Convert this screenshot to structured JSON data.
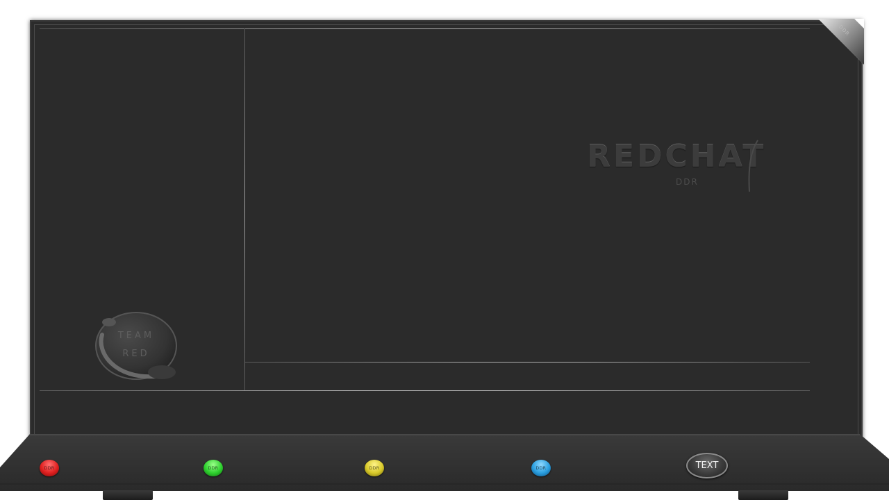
{
  "screen": {
    "brand": {
      "name": "REDCHAT",
      "sub": "DDR"
    },
    "badge": {
      "line1": "TEAM",
      "line2": "RED"
    },
    "corner_label": "DDR"
  },
  "footer": {
    "buttons": [
      {
        "label": "DDR",
        "color": "#e02020"
      },
      {
        "label": "DDR",
        "color": "#2fd12f"
      },
      {
        "label": "DDR",
        "color": "#d8c92a"
      },
      {
        "label": "DDR",
        "color": "#2a9fe0"
      }
    ],
    "text_button": "TEXT"
  }
}
